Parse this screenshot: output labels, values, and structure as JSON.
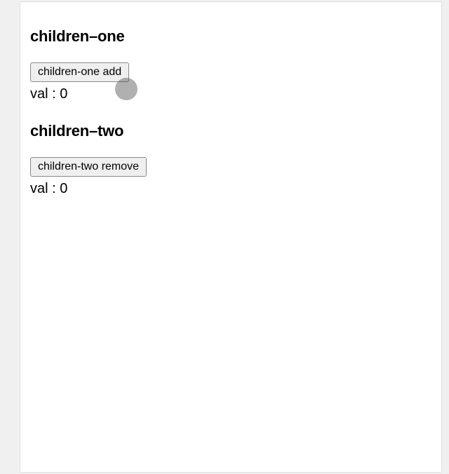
{
  "sections": {
    "one": {
      "heading": "children–one",
      "button_label": "children-one add",
      "value_prefix": "val : ",
      "value": 0
    },
    "two": {
      "heading": "children–two",
      "button_label": "children-two remove",
      "value_prefix": "val : ",
      "value": 0
    }
  }
}
